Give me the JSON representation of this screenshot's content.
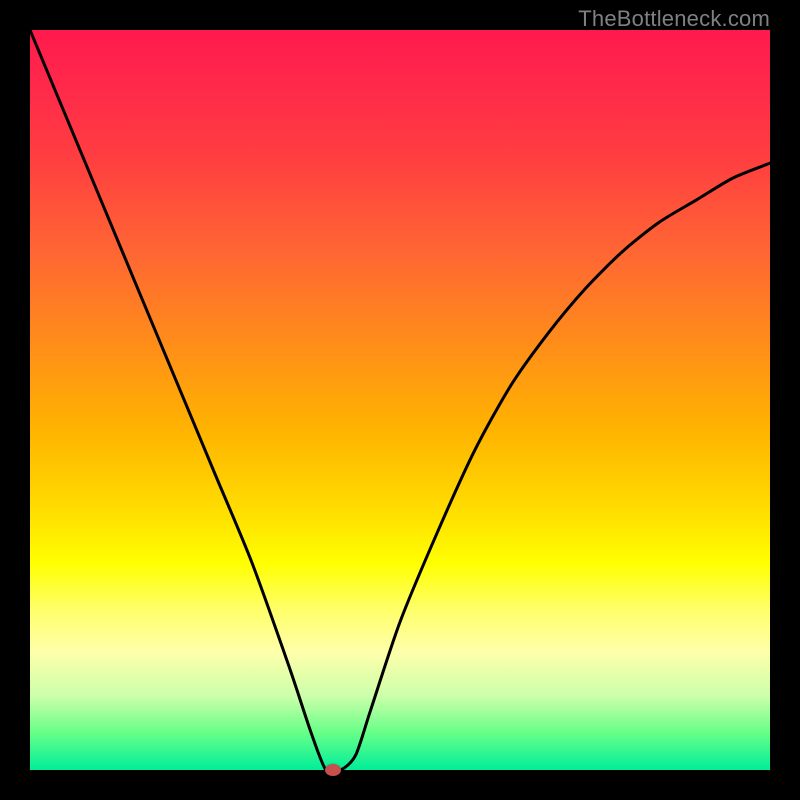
{
  "watermark": "TheBottleneck.com",
  "chart_data": {
    "type": "line",
    "title": "",
    "xlabel": "",
    "ylabel": "",
    "xlim": [
      0,
      100
    ],
    "ylim": [
      0,
      100
    ],
    "series": [
      {
        "name": "bottleneck-curve",
        "x": [
          0,
          5,
          10,
          15,
          20,
          25,
          30,
          35,
          38,
          40,
          42,
          44,
          46,
          50,
          55,
          60,
          65,
          70,
          75,
          80,
          85,
          90,
          95,
          100
        ],
        "values": [
          100,
          88,
          76,
          64,
          52,
          40,
          28,
          14,
          5,
          0,
          0,
          2,
          8,
          20,
          32,
          43,
          52,
          59,
          65,
          70,
          74,
          77,
          80,
          82
        ]
      }
    ],
    "marker": {
      "x": 41,
      "y": 0
    },
    "colors": {
      "curve": "#000000",
      "marker": "#c94f4f",
      "border": "#000000"
    }
  }
}
